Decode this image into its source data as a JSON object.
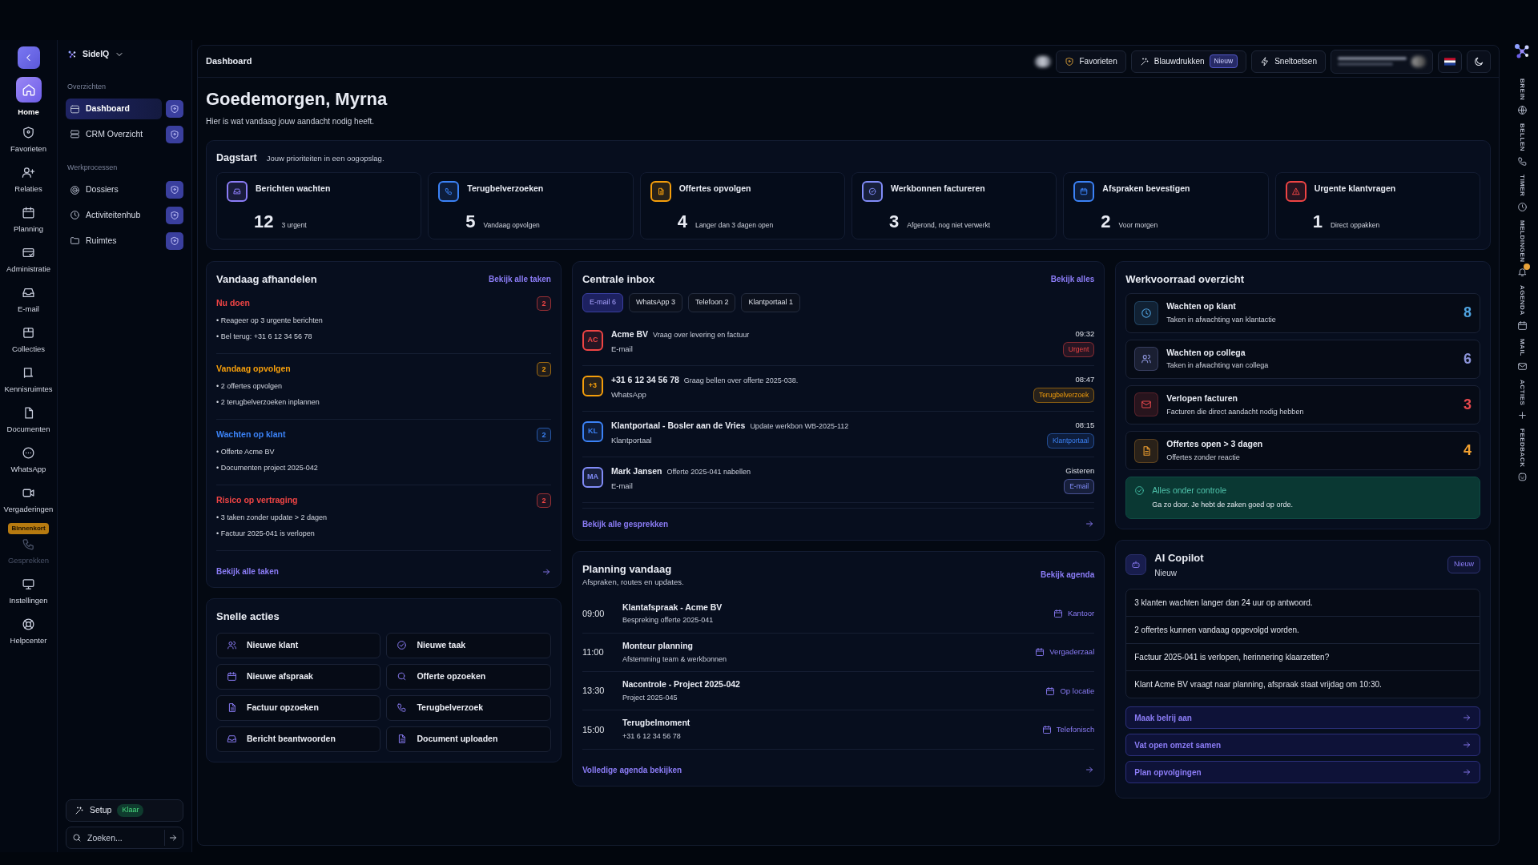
{
  "rail": {
    "items": [
      {
        "label": "Home",
        "selected": true,
        "disabled": false
      },
      {
        "label": "Favorieten",
        "selected": false,
        "disabled": false
      },
      {
        "label": "Relaties",
        "selected": false,
        "disabled": false
      },
      {
        "label": "Planning",
        "selected": false,
        "disabled": false
      },
      {
        "label": "Administratie",
        "selected": false,
        "disabled": false
      },
      {
        "label": "E-mail",
        "selected": false,
        "disabled": false
      },
      {
        "label": "Collecties",
        "selected": false,
        "disabled": false
      },
      {
        "label": "Kennisruimtes",
        "selected": false,
        "disabled": false
      },
      {
        "label": "Documenten",
        "selected": false,
        "disabled": false
      },
      {
        "label": "WhatsApp",
        "selected": false,
        "disabled": false
      },
      {
        "label": "Vergaderingen",
        "selected": false,
        "disabled": false
      },
      {
        "label": "Gesprekken",
        "selected": false,
        "disabled": true,
        "badge": "Binnenkort"
      },
      {
        "label": "Instellingen",
        "selected": false,
        "disabled": false
      },
      {
        "label": "Helpcenter",
        "selected": false,
        "disabled": false
      }
    ]
  },
  "sidebar": {
    "brand": "SideIQ",
    "sections": [
      {
        "title": "Overzichten",
        "items": [
          {
            "label": "Dashboard",
            "selected": true
          },
          {
            "label": "CRM Overzicht",
            "selected": false
          }
        ]
      },
      {
        "title": "Werkprocessen",
        "items": [
          {
            "label": "Dossiers",
            "selected": false
          },
          {
            "label": "Activiteitenhub",
            "selected": false
          },
          {
            "label": "Ruimtes",
            "selected": false
          }
        ]
      }
    ],
    "setup": {
      "label": "Setup",
      "status": "Klaar"
    },
    "search": {
      "placeholder": "Zoeken..."
    }
  },
  "topbar": {
    "title": "Dashboard",
    "buttons": [
      {
        "label": "Favorieten"
      },
      {
        "label": "Blauwdrukken",
        "badge": "Nieuw"
      },
      {
        "label": "Sneltoetsen"
      }
    ]
  },
  "greeting": {
    "title": "Goedemorgen, Myrna",
    "subtitle": "Hier is wat vandaag jouw aandacht nodig heeft."
  },
  "dagstart": {
    "title": "Dagstart",
    "subtitle": "Jouw prioriteiten in een oogopslag.",
    "tiles": [
      {
        "label": "Berichten wachten",
        "count": "12",
        "note": "3 urgent",
        "color": "#8b7cf6"
      },
      {
        "label": "Terugbelverzoeken",
        "count": "5",
        "note": "Vandaag opvolgen",
        "color": "#3b82f6"
      },
      {
        "label": "Offertes opvolgen",
        "count": "4",
        "note": "Langer dan 3 dagen open",
        "color": "#f59e0b"
      },
      {
        "label": "Werkbonnen factureren",
        "count": "3",
        "note": "Afgerond, nog niet verwerkt",
        "color": "#818cf8"
      },
      {
        "label": "Afspraken bevestigen",
        "count": "2",
        "note": "Voor morgen",
        "color": "#3b82f6"
      },
      {
        "label": "Urgente klantvragen",
        "count": "1",
        "note": "Direct oppakken",
        "color": "#ef4444"
      }
    ]
  },
  "today": {
    "title": "Vandaag afhandelen",
    "link": "Bekijk alle taken",
    "groups": [
      {
        "title": "Nu doen",
        "count": "2",
        "color": "#ef4444",
        "items": [
          "• Reageer op 3 urgente berichten",
          "• Bel terug: +31 6 12 34 56 78"
        ]
      },
      {
        "title": "Vandaag opvolgen",
        "count": "2",
        "color": "#f59e0b",
        "items": [
          "• 2 offertes opvolgen",
          "• 2 terugbelverzoeken inplannen"
        ]
      },
      {
        "title": "Wachten op klant",
        "count": "2",
        "color": "#3b82f6",
        "items": [
          "• Offerte Acme BV",
          "• Documenten project 2025-042"
        ]
      },
      {
        "title": "Risico op vertraging",
        "count": "2",
        "color": "#ef4444",
        "items": [
          "• 3 taken zonder update > 2 dagen",
          "• Factuur 2025-041 is verlopen"
        ]
      }
    ],
    "footer_link": "Bekijk alle taken"
  },
  "quick_actions": {
    "title": "Snelle acties",
    "actions": [
      "Nieuwe klant",
      "Nieuwe taak",
      "Nieuwe afspraak",
      "Offerte opzoeken",
      "Factuur opzoeken",
      "Terugbelverzoek",
      "Bericht beantwoorden",
      "Document uploaden"
    ]
  },
  "inbox": {
    "title": "Centrale inbox",
    "link": "Bekijk alles",
    "filters": [
      {
        "label": "E-mail 6",
        "selected": true
      },
      {
        "label": "WhatsApp 3",
        "selected": false
      },
      {
        "label": "Telefoon 2",
        "selected": false
      },
      {
        "label": "Klantportaal 1",
        "selected": false
      }
    ],
    "messages": [
      {
        "initials": "AC",
        "sender": "Acme BV",
        "subject": "Vraag over levering en factuur",
        "channel": "E-mail",
        "time": "09:32",
        "tag": "Urgent",
        "color": "#ef4444"
      },
      {
        "initials": "+3",
        "sender": "+31 6 12 34 56 78",
        "subject": "Graag bellen over offerte 2025-038.",
        "channel": "WhatsApp",
        "time": "08:47",
        "tag": "Terugbelverzoek",
        "color": "#f59e0b"
      },
      {
        "initials": "KL",
        "sender": "Klantportaal - Bosler aan de Vries",
        "subject": "Update werkbon WB-2025-112",
        "channel": "Klantportaal",
        "time": "08:15",
        "tag": "Klantportaal",
        "color": "#3b82f6"
      },
      {
        "initials": "MA",
        "sender": "Mark Jansen",
        "subject": "Offerte 2025-041 nabellen",
        "channel": "E-mail",
        "time": "Gisteren",
        "tag": "E-mail",
        "color": "#818cf8"
      }
    ],
    "footer_link": "Bekijk alle gesprekken"
  },
  "planning": {
    "title": "Planning vandaag",
    "subtitle": "Afspraken, routes en updates.",
    "link": "Bekijk agenda",
    "events": [
      {
        "time": "09:00",
        "title": "Klantafspraak - Acme BV",
        "detail": "Bespreking offerte 2025-041",
        "location": "Kantoor"
      },
      {
        "time": "11:00",
        "title": "Monteur planning",
        "detail": "Afstemming team & werkbonnen",
        "location": "Vergaderzaal"
      },
      {
        "time": "13:30",
        "title": "Nacontrole - Project 2025-042",
        "detail": "Project 2025-045",
        "location": "Op locatie"
      },
      {
        "time": "15:00",
        "title": "Terugbelmoment",
        "detail": "+31 6 12 34 56 78",
        "location": "Telefonisch"
      }
    ],
    "footer_link": "Volledige agenda bekijken"
  },
  "workload": {
    "title": "Werkvoorraad overzicht",
    "items": [
      {
        "title": "Wachten op klant",
        "detail": "Taken in afwachting van klantactie",
        "count": "8",
        "color": "#4fa3e0"
      },
      {
        "title": "Wachten op collega",
        "detail": "Taken in afwachting van collega",
        "count": "6",
        "color": "#8b93d8"
      },
      {
        "title": "Verlopen facturen",
        "detail": "Facturen die direct aandacht nodig hebben",
        "count": "3",
        "color": "#e5484d"
      },
      {
        "title": "Offertes open > 3 dagen",
        "detail": "Offertes zonder reactie",
        "count": "4",
        "color": "#f0a030"
      }
    ],
    "status": {
      "title": "Alles onder controle",
      "text": "Ga zo door. Je hebt de zaken goed op orde."
    }
  },
  "copilot": {
    "title": "AI Copilot",
    "subtitle": "Nieuw",
    "badge": "Nieuw",
    "insights": [
      "3 klanten wachten langer dan 24 uur op antwoord.",
      "2 offertes kunnen vandaag opgevolgd worden.",
      "Factuur 2025-041 is verlopen, herinnering klaarzetten?",
      "Klant Acme BV vraagt naar planning, afspraak staat vrijdag om 10:30."
    ],
    "actions": [
      "Maak belrij aan",
      "Vat open omzet samen",
      "Plan opvolgingen"
    ]
  },
  "right_rail": {
    "items": [
      {
        "label": "BREIN",
        "unread": false
      },
      {
        "label": "BELLEN",
        "unread": false
      },
      {
        "label": "TIMER",
        "unread": false
      },
      {
        "label": "MELDINGEN",
        "unread": true
      },
      {
        "label": "AGENDA",
        "unread": false
      },
      {
        "label": "MAIL",
        "unread": false
      },
      {
        "label": "ACTIES",
        "unread": false
      },
      {
        "label": "FEEDBACK",
        "unread": false
      }
    ]
  }
}
